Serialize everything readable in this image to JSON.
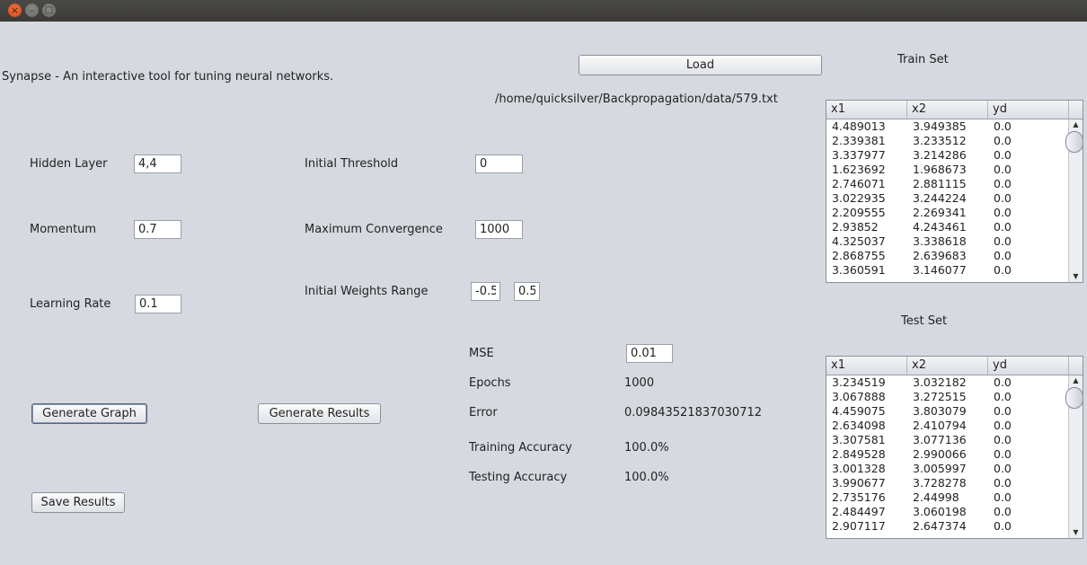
{
  "window": {
    "close_glyph": "×",
    "min_glyph": "–",
    "max_glyph": "□"
  },
  "app": {
    "description": "Synapse - An interactive tool for tuning neural networks.",
    "file_path": "/home/quicksilver/Backpropagation/data/579.txt",
    "load_label": "Load"
  },
  "params": {
    "hidden_layer_label": "Hidden Layer",
    "hidden_layer_value": "4,4",
    "momentum_label": "Momentum",
    "momentum_value": "0.7",
    "learning_rate_label": "Learning Rate",
    "learning_rate_value": "0.1",
    "initial_threshold_label": "Initial Threshold",
    "initial_threshold_value": "0",
    "max_convergence_label": "Maximum Convergence",
    "max_convergence_value": "1000",
    "weights_range_label": "Initial Weights Range",
    "weights_range_min": "-0.5",
    "weights_range_max": "0.5",
    "mse_label": "MSE",
    "mse_value": "0.01"
  },
  "buttons": {
    "generate_graph": "Generate Graph",
    "generate_results": "Generate Results",
    "save_results": "Save Results"
  },
  "results": {
    "epochs_label": "Epochs",
    "epochs_value": "1000",
    "error_label": "Error",
    "error_value": "0.09843521837030712",
    "training_accuracy_label": "Training Accuracy",
    "training_accuracy_value": "100.0%",
    "testing_accuracy_label": "Testing Accuracy",
    "testing_accuracy_value": "100.0%"
  },
  "train_set": {
    "title": "Train Set",
    "columns": [
      "x1",
      "x2",
      "yd"
    ],
    "rows": [
      [
        "4.489013",
        "3.949385",
        "0.0"
      ],
      [
        "2.339381",
        "3.233512",
        "0.0"
      ],
      [
        "3.337977",
        "3.214286",
        "0.0"
      ],
      [
        "1.623692",
        "1.968673",
        "0.0"
      ],
      [
        "2.746071",
        "2.881115",
        "0.0"
      ],
      [
        "3.022935",
        "3.244224",
        "0.0"
      ],
      [
        "2.209555",
        "2.269341",
        "0.0"
      ],
      [
        "2.93852",
        "4.243461",
        "0.0"
      ],
      [
        "4.325037",
        "3.338618",
        "0.0"
      ],
      [
        "2.868755",
        "2.639683",
        "0.0"
      ],
      [
        "3.360591",
        "3.146077",
        "0.0"
      ]
    ]
  },
  "test_set": {
    "title": "Test Set",
    "columns": [
      "x1",
      "x2",
      "yd"
    ],
    "rows": [
      [
        "3.234519",
        "3.032182",
        "0.0"
      ],
      [
        "3.067888",
        "3.272515",
        "0.0"
      ],
      [
        "4.459075",
        "3.803079",
        "0.0"
      ],
      [
        "2.634098",
        "2.410794",
        "0.0"
      ],
      [
        "3.307581",
        "3.077136",
        "0.0"
      ],
      [
        "2.849528",
        "2.990066",
        "0.0"
      ],
      [
        "3.001328",
        "3.005997",
        "0.0"
      ],
      [
        "3.990677",
        "3.728278",
        "0.0"
      ],
      [
        "2.735176",
        "2.44998",
        "0.0"
      ],
      [
        "2.484497",
        "3.060198",
        "0.0"
      ],
      [
        "2.907117",
        "2.647374",
        "0.0"
      ]
    ]
  }
}
